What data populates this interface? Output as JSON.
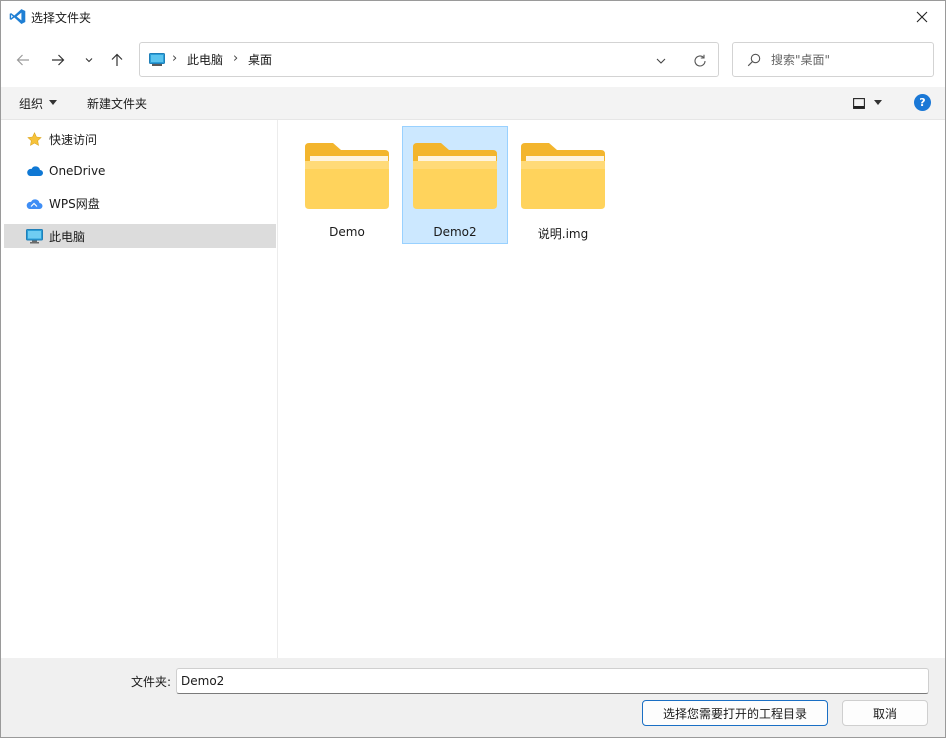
{
  "window": {
    "title": "选择文件夹",
    "app_icon": "vscode-icon"
  },
  "navigation": {
    "breadcrumbs": [
      "此电脑",
      "桌面"
    ],
    "search_placeholder": "搜索\"桌面\""
  },
  "toolbar": {
    "organize_label": "组织",
    "new_folder_label": "新建文件夹"
  },
  "sidebar": {
    "items": [
      {
        "label": "快速访问",
        "icon": "star-icon"
      },
      {
        "label": "OneDrive",
        "icon": "onedrive-cloud-icon"
      },
      {
        "label": "WPS网盘",
        "icon": "wps-cloud-icon"
      },
      {
        "label": "此电脑",
        "icon": "computer-icon",
        "selected": true
      }
    ]
  },
  "content": {
    "items": [
      {
        "label": "Demo",
        "type": "folder"
      },
      {
        "label": "Demo2",
        "type": "folder",
        "selected": true
      },
      {
        "label": "说明.img",
        "type": "folder"
      }
    ]
  },
  "footer": {
    "folder_label": "文件夹:",
    "folder_value": "Demo2",
    "select_button": "选择您需要打开的工程目录",
    "cancel_button": "取消"
  },
  "colors": {
    "accent": "#1a78d6",
    "selection_bg": "#cce8ff",
    "folder_yellow": "#ffd35c"
  }
}
